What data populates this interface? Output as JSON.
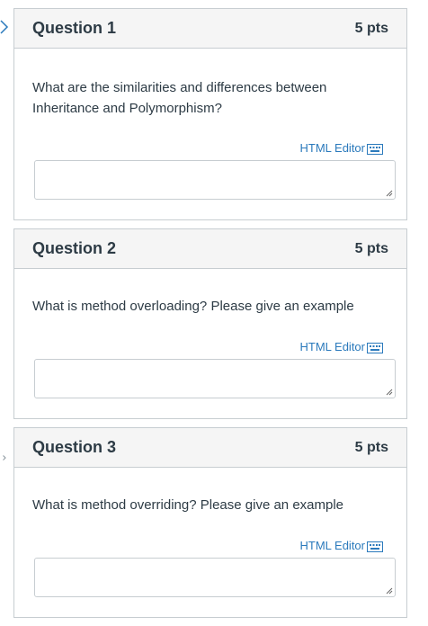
{
  "questions": [
    {
      "title": "Question 1",
      "points": "5 pts",
      "text": "What are the similarities and differences between Inheritance and Polymorphism?",
      "editor_link": "HTML Editor",
      "answer_value": ""
    },
    {
      "title": "Question 2",
      "points": "5 pts",
      "text": "What is method overloading? Please give an example",
      "editor_link": "HTML Editor",
      "answer_value": ""
    },
    {
      "title": "Question 3",
      "points": "5 pts",
      "text": "What is method overriding? Please give an example",
      "editor_link": "HTML Editor",
      "answer_value": ""
    }
  ],
  "colors": {
    "link": "#2b7abc",
    "header_bg": "#f5f5f5",
    "border": "#c7cdd1",
    "text": "#2d3b45",
    "chevron": "#2b7abc"
  },
  "icons": {
    "editor_toggle": "keyboard-icon",
    "resize": "resize-grip-icon",
    "nav": "chevron-right-icon"
  }
}
